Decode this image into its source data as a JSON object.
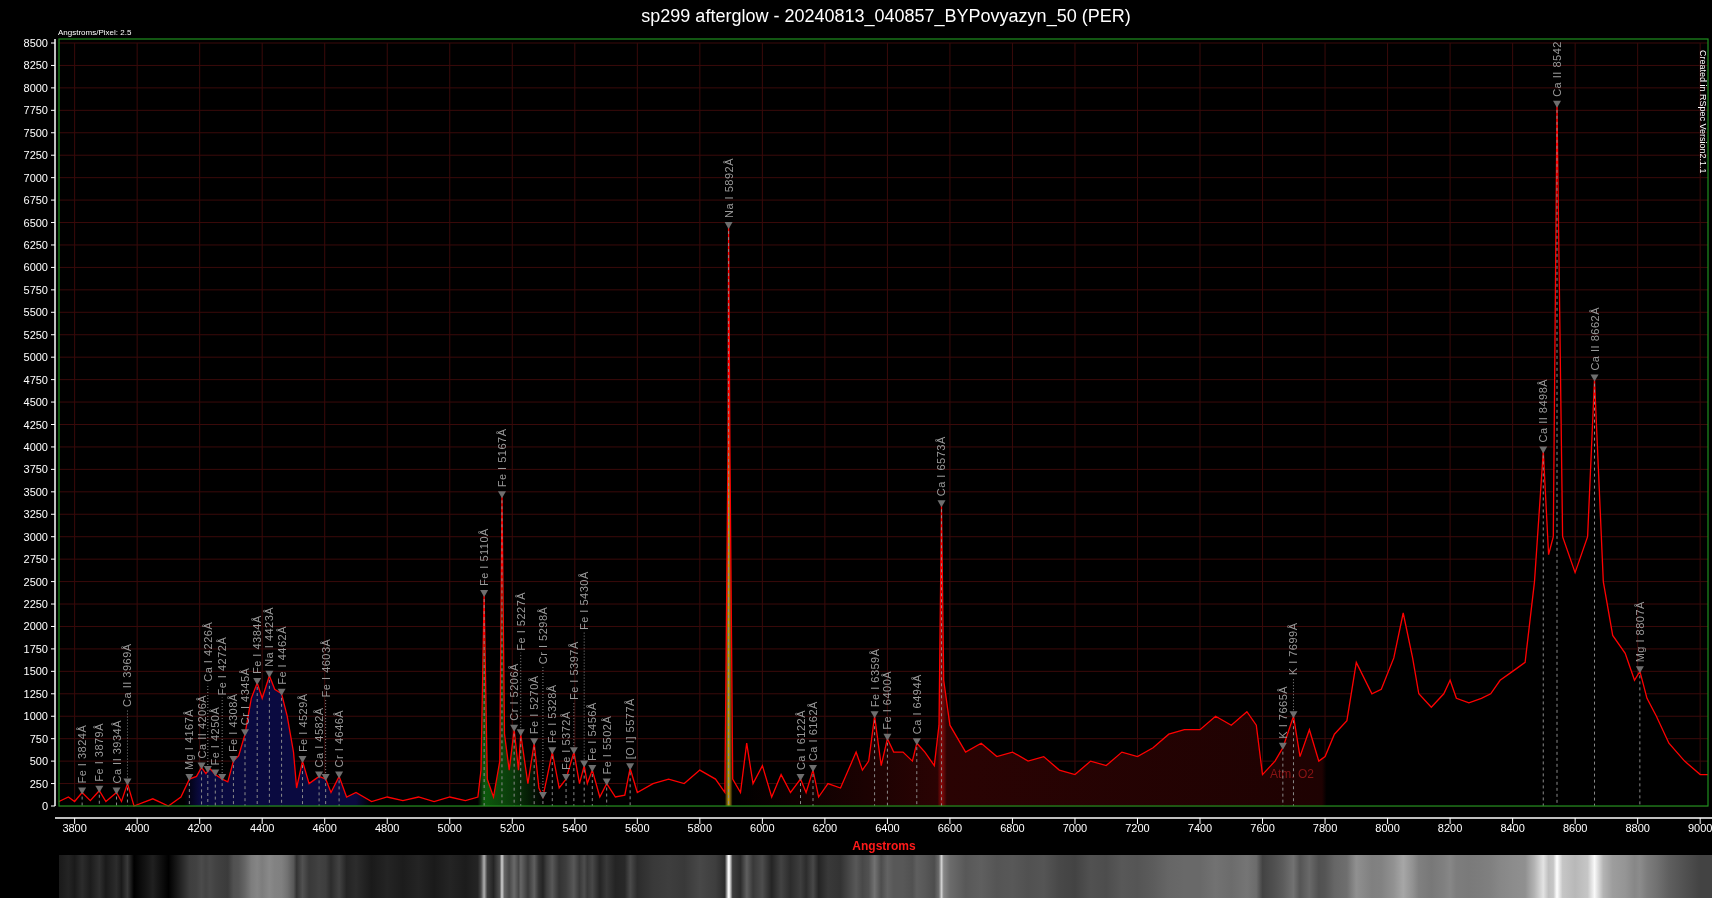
{
  "scale_note": "Angstroms/Pixel: 2.5",
  "credit": "Created in RSpec Version2.1.1",
  "band_label": "Atm. O2",
  "chart_data": {
    "type": "area",
    "grid": true,
    "title": "sp299 afterglow - 20240813_040857_BYPovyazyn_50 (PER)",
    "xlabel": "Angstroms",
    "xlim": [
      3750,
      9025
    ],
    "ylim": [
      0,
      8500
    ],
    "xticks": [
      3800,
      4000,
      4200,
      4400,
      4600,
      4800,
      5000,
      5200,
      5400,
      5600,
      5800,
      6000,
      6200,
      6400,
      6600,
      6800,
      7000,
      7200,
      7400,
      7600,
      7800,
      8000,
      8200,
      8400,
      8600,
      8800,
      9000
    ],
    "yticks": [
      0,
      250,
      500,
      750,
      1000,
      1250,
      1500,
      1750,
      2000,
      2250,
      2500,
      2750,
      3000,
      3250,
      3500,
      3750,
      4000,
      4250,
      4500,
      4750,
      5000,
      5250,
      5500,
      5750,
      6000,
      6250,
      6500,
      6750,
      7000,
      7250,
      7500,
      7750,
      8000,
      8250,
      8500
    ],
    "x": [
      3750,
      3780,
      3800,
      3824,
      3850,
      3879,
      3900,
      3934,
      3950,
      3969,
      3990,
      4050,
      4100,
      4140,
      4167,
      4190,
      4206,
      4220,
      4232,
      4250,
      4272,
      4290,
      4308,
      4325,
      4345,
      4365,
      4384,
      4400,
      4423,
      4440,
      4462,
      4480,
      4500,
      4510,
      4529,
      4550,
      4570,
      4582,
      4603,
      4620,
      4646,
      4670,
      4700,
      4750,
      4800,
      4850,
      4900,
      4950,
      5000,
      5050,
      5090,
      5100,
      5110,
      5120,
      5140,
      5160,
      5167,
      5175,
      5190,
      5206,
      5220,
      5227,
      5250,
      5270,
      5285,
      5298,
      5310,
      5328,
      5350,
      5372,
      5397,
      5415,
      5430,
      5440,
      5456,
      5480,
      5502,
      5530,
      5560,
      5577,
      5600,
      5650,
      5700,
      5750,
      5800,
      5850,
      5880,
      5890,
      5892,
      5896,
      5905,
      5930,
      5950,
      5970,
      6000,
      6030,
      6060,
      6090,
      6122,
      6140,
      6162,
      6180,
      6210,
      6250,
      6300,
      6320,
      6340,
      6359,
      6380,
      6400,
      6420,
      6450,
      6480,
      6494,
      6520,
      6550,
      6565,
      6573,
      6580,
      6600,
      6650,
      6700,
      6750,
      6800,
      6850,
      6900,
      6950,
      7000,
      7050,
      7100,
      7150,
      7200,
      7250,
      7300,
      7350,
      7400,
      7450,
      7500,
      7550,
      7580,
      7600,
      7640,
      7665,
      7699,
      7720,
      7750,
      7780,
      7800,
      7830,
      7870,
      7900,
      7950,
      7980,
      8020,
      8050,
      8080,
      8100,
      8140,
      8180,
      8200,
      8220,
      8260,
      8300,
      8330,
      8360,
      8400,
      8440,
      8470,
      8498,
      8515,
      8530,
      8542,
      8560,
      8600,
      8640,
      8662,
      8690,
      8720,
      8760,
      8790,
      8807,
      8830,
      8860,
      8900,
      8950,
      9000,
      9025
    ],
    "series": [
      {
        "color": "#ff0000",
        "values": [
          50,
          100,
          50,
          150,
          60,
          170,
          50,
          150,
          50,
          250,
          0,
          80,
          0,
          100,
          300,
          330,
          430,
          360,
          420,
          350,
          300,
          270,
          500,
          560,
          800,
          1200,
          1370,
          1200,
          1450,
          1300,
          1250,
          1000,
          600,
          200,
          500,
          250,
          300,
          330,
          300,
          150,
          330,
          100,
          150,
          50,
          100,
          60,
          100,
          50,
          100,
          60,
          100,
          400,
          2350,
          300,
          100,
          500,
          3450,
          800,
          400,
          850,
          400,
          800,
          250,
          700,
          200,
          100,
          300,
          600,
          200,
          300,
          600,
          250,
          450,
          250,
          400,
          100,
          250,
          100,
          120,
          420,
          150,
          250,
          300,
          250,
          400,
          300,
          150,
          4000,
          6450,
          4000,
          300,
          150,
          700,
          250,
          450,
          100,
          350,
          150,
          300,
          150,
          400,
          100,
          250,
          200,
          600,
          400,
          500,
          1000,
          450,
          750,
          600,
          600,
          500,
          700,
          600,
          450,
          900,
          3350,
          1400,
          900,
          600,
          700,
          550,
          600,
          500,
          550,
          400,
          350,
          500,
          450,
          600,
          550,
          650,
          800,
          850,
          850,
          1000,
          900,
          1050,
          900,
          350,
          500,
          650,
          1000,
          550,
          850,
          500,
          550,
          800,
          950,
          1600,
          1250,
          1300,
          1650,
          2150,
          1650,
          1250,
          1100,
          1250,
          1400,
          1200,
          1150,
          1200,
          1250,
          1400,
          1500,
          1600,
          2500,
          3950,
          2800,
          3000,
          7800,
          3000,
          2600,
          3000,
          4750,
          2500,
          1900,
          1700,
          1400,
          1500,
          1200,
          1000,
          700,
          500,
          350,
          350
        ]
      }
    ],
    "annotations": [
      {
        "x": 3824,
        "text": "Fe I 3824Å"
      },
      {
        "x": 3879,
        "text": "Fe I 3879Å"
      },
      {
        "x": 3934,
        "text": "Ca II 3934Å"
      },
      {
        "x": 3969,
        "text": "Ca II 3969Å"
      },
      {
        "x": 4167,
        "text": "Mg I 4167Å"
      },
      {
        "x": 4206,
        "text": "Ca II 4206Å"
      },
      {
        "x": 4226,
        "text": "Ca I 4226Å"
      },
      {
        "x": 4250,
        "text": "Fe I 4250Å"
      },
      {
        "x": 4272,
        "text": "Fe I 4272Å"
      },
      {
        "x": 4308,
        "text": "Fe I 4308Å"
      },
      {
        "x": 4345,
        "text": "Cr I 4345Å"
      },
      {
        "x": 4384,
        "text": "Fe I 4384Å"
      },
      {
        "x": 4423,
        "text": "Na I 4423Å"
      },
      {
        "x": 4462,
        "text": "Fe I 4462Å"
      },
      {
        "x": 4529,
        "text": "Fe I 4529Å"
      },
      {
        "x": 4582,
        "text": "Ca I 4582Å"
      },
      {
        "x": 4603,
        "text": "Fe I 4603Å"
      },
      {
        "x": 4646,
        "text": "Cr I 4646Å"
      },
      {
        "x": 5110,
        "text": "Fe I 5110Å"
      },
      {
        "x": 5167,
        "text": "Fe I 5167Å"
      },
      {
        "x": 5206,
        "text": "Cr I 5206Å"
      },
      {
        "x": 5227,
        "text": "Fe I 5227Å"
      },
      {
        "x": 5270,
        "text": "Fe I 5270Å"
      },
      {
        "x": 5298,
        "text": "Cr I 5298Å"
      },
      {
        "x": 5328,
        "text": "Fe I 5328Å"
      },
      {
        "x": 5372,
        "text": "Fe I 5372Å"
      },
      {
        "x": 5397,
        "text": "Fe I 5397Å"
      },
      {
        "x": 5430,
        "text": "Fe I 5430Å"
      },
      {
        "x": 5456,
        "text": "Fe I 5456Å"
      },
      {
        "x": 5502,
        "text": "Fe I 5502Å"
      },
      {
        "x": 5577,
        "text": "[O I] 5577Å"
      },
      {
        "x": 5892,
        "text": "Na I 5892Å"
      },
      {
        "x": 6122,
        "text": "Ca I 6122Å"
      },
      {
        "x": 6162,
        "text": "Ca I 6162Å"
      },
      {
        "x": 6359,
        "text": "Fe I 6359Å"
      },
      {
        "x": 6400,
        "text": "Fe I 6400Å"
      },
      {
        "x": 6494,
        "text": "Ca I 6494Å"
      },
      {
        "x": 6573,
        "text": "Ca I 6573Å"
      },
      {
        "x": 7665,
        "text": "K I 7665Å"
      },
      {
        "x": 7699,
        "text": "K I 7699Å"
      },
      {
        "x": 8498,
        "text": "Ca II 8498Å"
      },
      {
        "x": 8542,
        "text": "Ca II 8542"
      },
      {
        "x": 8662,
        "text": "Ca II 8662Å"
      },
      {
        "x": 8807,
        "text": "Mg I 8807Å"
      }
    ]
  }
}
